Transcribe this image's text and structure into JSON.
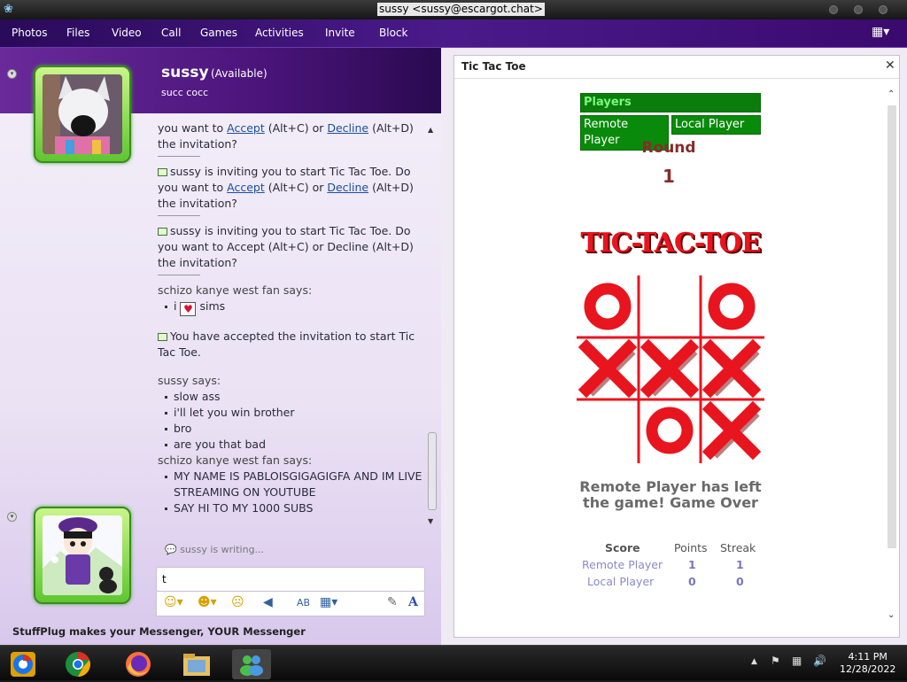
{
  "window": {
    "title": "sussy <sussy@escargot.chat>"
  },
  "menu": [
    "Photos",
    "Files",
    "Video",
    "Call",
    "Games",
    "Activities",
    "Invite",
    "Block"
  ],
  "contact": {
    "name": "sussy",
    "status": "(Available)",
    "personal_message": "succ cocc"
  },
  "history": {
    "msg1_text": "you want to ",
    "accept": "Accept",
    "shortcut_accept": " (Alt+C) or ",
    "decline": "Decline",
    "shortcut_decline": " (Alt+D)",
    "the_invitation": "the invitation?",
    "invite_line": "sussy is inviting you to start Tic Tac Toe. Do you want to ",
    "invite_plain": "sussy is inviting you to start Tic Tac Toe. Do you want to Accept (Alt+C) or Decline (Alt+D) the invitation?",
    "schizo_says": "schizo kanye west fan says:",
    "i": "i",
    "sims": "sims",
    "accepted": "You have accepted the invitation to start Tic Tac Toe.",
    "sussy_says": "sussy says:",
    "sussy_lines": [
      "slow ass",
      "i'll let you win brother",
      "bro",
      "are you that bad"
    ],
    "schizo_lines": [
      "MY NAME IS PABLOISGIGAGIGFA AND IM LIVE STREAMING ON YOUTUBE",
      "SAY HI TO MY 1000 SUBS"
    ]
  },
  "typing_status": "sussy is writing...",
  "input": {
    "value": "t"
  },
  "footer": "StuffPlug makes your Messenger, YOUR Messenger",
  "game": {
    "title": "Tic Tac Toe",
    "players_header": "Players",
    "remote_player": "Remote Player",
    "local_player": "Local Player",
    "round_label": "Round",
    "round_value": "1",
    "logo": "TIC-TAC-TOE",
    "board": [
      "O",
      "",
      "O",
      "X",
      "X",
      "X",
      "",
      "O",
      "X"
    ],
    "message": "Remote Player has left the game! Game Over",
    "score": {
      "headers": [
        "Score",
        "Points",
        "Streak"
      ],
      "rows": [
        {
          "name": "Remote Player",
          "points": "1",
          "streak": "1"
        },
        {
          "name": "Local Player",
          "points": "0",
          "streak": "0"
        }
      ]
    }
  },
  "clock": {
    "time": "4:11 PM",
    "date": "12/28/2022"
  },
  "colors": {
    "menu_bg": "#3a0f72",
    "game_green": "#0a8a0a",
    "board_red": "#e8141e",
    "round_color": "#8b2a2a"
  }
}
